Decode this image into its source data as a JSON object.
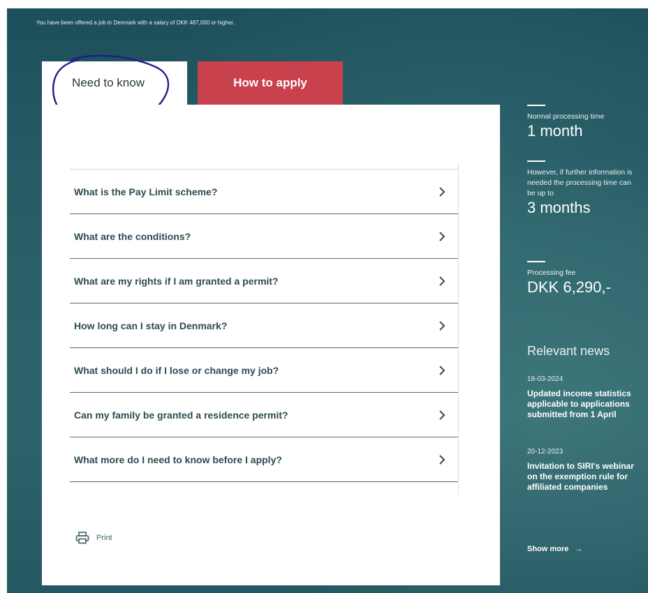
{
  "intro_text": "You have been offered a job in Denmark with a salary of DKK 487,000 or higher.",
  "tabs": [
    {
      "label": "Need to know",
      "active": true
    },
    {
      "label": "How to apply",
      "active": false
    }
  ],
  "questions": [
    "What is the Pay Limit scheme?",
    "What are the conditions?",
    "What are my rights if I am granted a permit?",
    "How long can I stay in Denmark?",
    "What should I do if I lose or change my job?",
    "Can my family be granted a residence permit?",
    "What more do I need to know before I apply?"
  ],
  "print_label": "Print",
  "sidebar": {
    "processing_label": "Normal processing time",
    "processing_value": "1 month",
    "extended_label": "However, if further information is needed the processing time can be up to",
    "extended_value": "3 months",
    "fee_label": "Processing fee",
    "fee_value": "DKK 6,290,-"
  },
  "news": {
    "heading": "Relevant news",
    "items": [
      {
        "date": "18-03-2024",
        "title": "Updated income statistics applicable to applications submitted from 1 April"
      },
      {
        "date": "20-12-2023",
        "title": "Invitation to SIRI's webinar on the exemption rule for affiliated companies"
      }
    ],
    "show_more": "Show more"
  },
  "icons": {
    "chevron": "chevron-right-icon",
    "print": "printer-icon",
    "arrow": "arrow-right-icon"
  },
  "colors": {
    "teal_background": "#2a5f68",
    "apply_tab": "#c8414d",
    "question_text": "#2e4a52",
    "annotation_circle": "#1c1f8a"
  }
}
